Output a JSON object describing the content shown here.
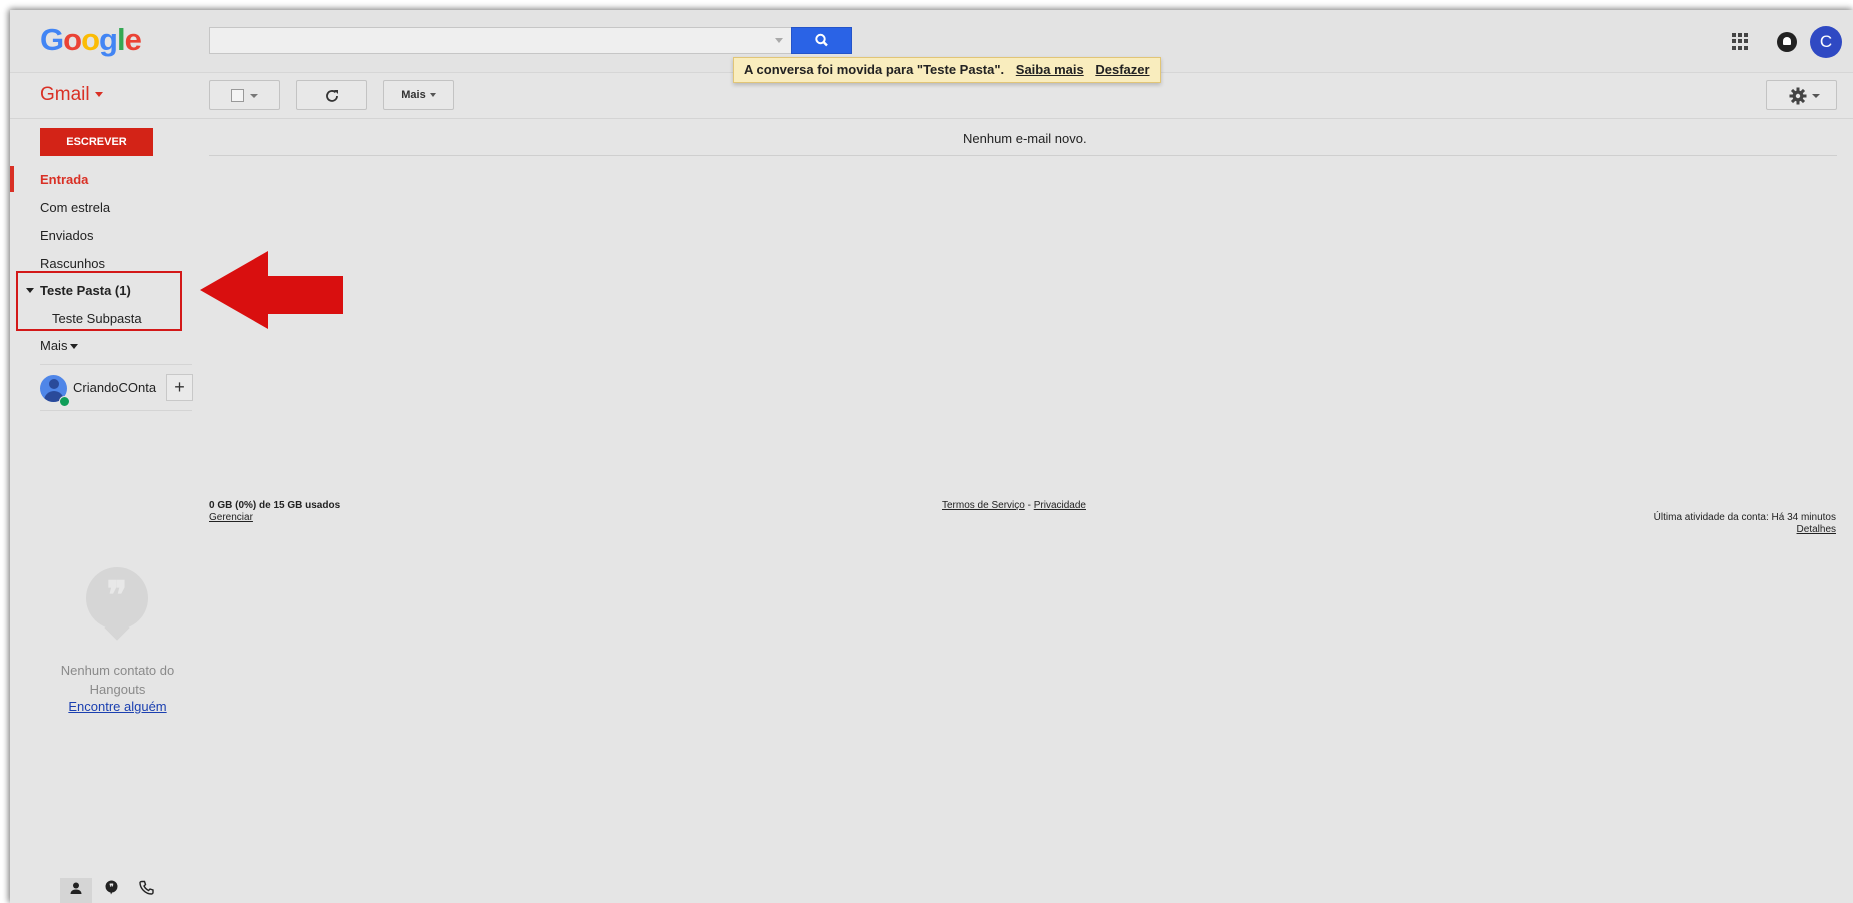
{
  "header": {
    "logo_letters": [
      {
        "char": "G",
        "color": "#4285f4"
      },
      {
        "char": "o",
        "color": "#ea4335"
      },
      {
        "char": "o",
        "color": "#fbbc05"
      },
      {
        "char": "g",
        "color": "#4285f4"
      },
      {
        "char": "l",
        "color": "#34a853"
      },
      {
        "char": "e",
        "color": "#ea4335"
      }
    ],
    "search_placeholder": "",
    "account_initial": "C"
  },
  "toolbar": {
    "app_label": "Gmail",
    "more_label": "Mais"
  },
  "notification": {
    "text": "A conversa foi movida para \"Teste Pasta\".",
    "learn_more": "Saiba mais",
    "undo": "Desfazer"
  },
  "sidebar": {
    "compose_label": "ESCREVER",
    "items": [
      {
        "label": "Entrada"
      },
      {
        "label": "Com estrela"
      },
      {
        "label": "Enviados"
      },
      {
        "label": "Rascunhos"
      },
      {
        "label": "Teste Pasta (1)"
      },
      {
        "label": "Teste Subpasta"
      },
      {
        "label": "Mais"
      }
    ],
    "account_name": "CriandoCOnta",
    "plus_label": "+"
  },
  "hangouts": {
    "empty_text": "Nenhum contato do Hangouts",
    "find_link": "Encontre alguém"
  },
  "main": {
    "empty_message": "Nenhum e-mail novo."
  },
  "footer": {
    "storage": "0 GB (0%) de 15 GB usados",
    "manage": "Gerenciar",
    "terms": "Termos de Serviço",
    "separator": "-",
    "privacy": "Privacidade",
    "last_activity": "Última atividade da conta: Há 34 minutos",
    "details": "Detalhes"
  },
  "colors": {
    "accent_red": "#d93025",
    "compose_red": "#d32317",
    "search_blue": "#2a63e6",
    "notice_bg": "#f9edbe",
    "annotation_red": "#d31818"
  },
  "icons": [
    "search-icon",
    "apps-grid-icon",
    "notifications-icon",
    "refresh-icon",
    "settings-gear-icon",
    "person-icon",
    "hangouts-quote-icon",
    "phone-icon",
    "red-arrow-annotation"
  ]
}
